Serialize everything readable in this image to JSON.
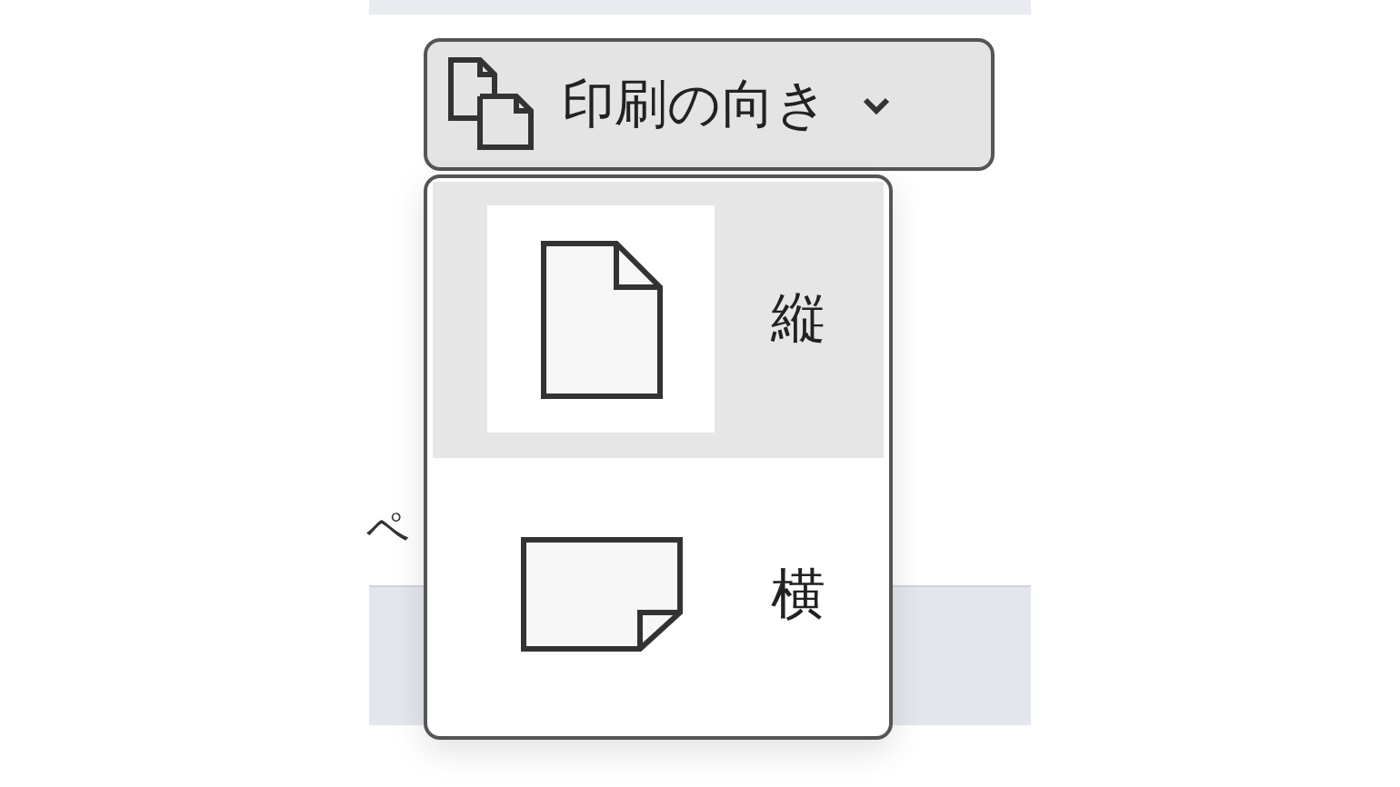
{
  "orientation_button": {
    "label": "印刷の向き",
    "expanded": true
  },
  "menu": {
    "items": [
      {
        "label": "縦",
        "kind": "portrait",
        "selected": true
      },
      {
        "label": "横",
        "kind": "landscape",
        "selected": false
      }
    ]
  },
  "page_text": "ペ"
}
